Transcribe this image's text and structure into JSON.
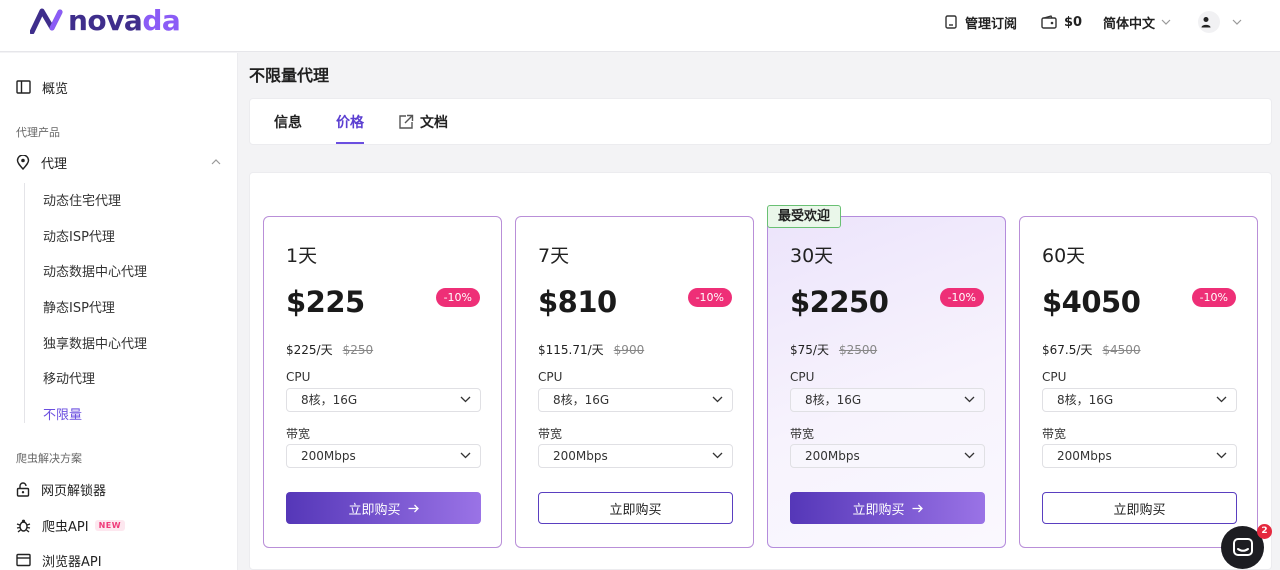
{
  "brand": {
    "name_main": "nova",
    "name_accent": "da"
  },
  "header": {
    "manage_label": "管理订阅",
    "balance": "$0",
    "language": "简体中文"
  },
  "sidebar": {
    "overview": "概览",
    "section_proxy": "代理产品",
    "proxy": "代理",
    "sub_items": [
      "动态住宅代理",
      "动态ISP代理",
      "动态数据中心代理",
      "静态ISP代理",
      "独享数据中心代理",
      "移动代理",
      "不限量"
    ],
    "section_scraper": "爬虫解决方案",
    "web_unlocker": "网页解锁器",
    "scraper_api": "爬虫API",
    "new_badge": "NEW",
    "browser_api": "浏览器API"
  },
  "page": {
    "title": "不限量代理",
    "tabs": {
      "info": "信息",
      "price": "价格",
      "docs": "文档"
    }
  },
  "popular_tag": "最受欢迎",
  "field_labels": {
    "cpu": "CPU",
    "bandwidth": "带宽"
  },
  "buy_label": "立即购买",
  "plans": [
    {
      "days": "1天",
      "price": "$225",
      "discount": "-10%",
      "per_day": "$225/天",
      "original": "$250",
      "cpu": "8核，16G",
      "bandwidth": "200Mbps"
    },
    {
      "days": "7天",
      "price": "$810",
      "discount": "-10%",
      "per_day": "$115.71/天",
      "original": "$900",
      "cpu": "8核，16G",
      "bandwidth": "200Mbps"
    },
    {
      "days": "30天",
      "price": "$2250",
      "discount": "-10%",
      "per_day": "$75/天",
      "original": "$2500",
      "cpu": "8核，16G",
      "bandwidth": "200Mbps"
    },
    {
      "days": "60天",
      "price": "$4050",
      "discount": "-10%",
      "per_day": "$67.5/天",
      "original": "$4500",
      "cpu": "8核，16G",
      "bandwidth": "200Mbps"
    }
  ],
  "chat": {
    "unread": "2"
  },
  "colors": {
    "accent": "#6b4fe0",
    "discount": "#ee2f77",
    "popular": "#69c073"
  }
}
